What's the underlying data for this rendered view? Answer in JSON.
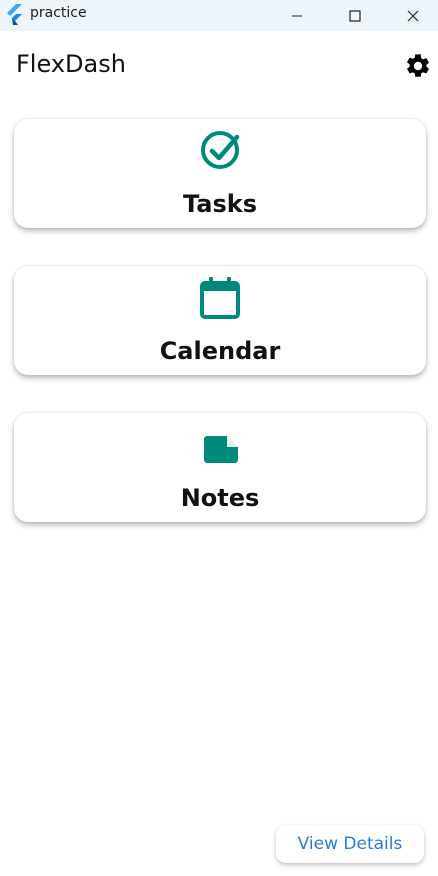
{
  "window": {
    "title": "practice"
  },
  "appbar": {
    "title": "FlexDash"
  },
  "cards": [
    {
      "label": "Tasks",
      "icon": "check-circle-icon"
    },
    {
      "label": "Calendar",
      "icon": "calendar-icon"
    },
    {
      "label": "Notes",
      "icon": "note-icon"
    }
  ],
  "actions": {
    "view_details": "View Details"
  },
  "colors": {
    "accent": "#00897b",
    "link": "#2a7cd3",
    "titlebar": "#eef5fa"
  }
}
